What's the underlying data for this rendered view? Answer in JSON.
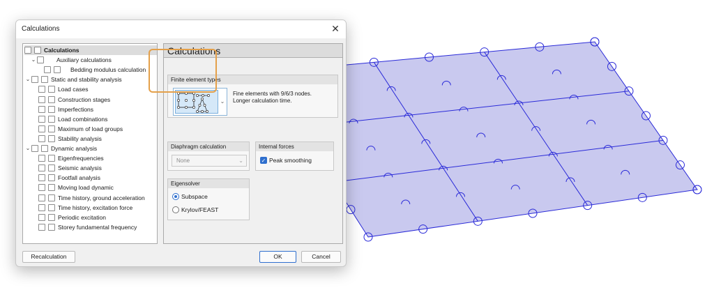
{
  "dialog": {
    "title": "Calculations",
    "close_glyph": "✕"
  },
  "tree": {
    "items": [
      {
        "label": "Calculations",
        "bold": true,
        "twisty": ""
      },
      {
        "label": "Auxiliary calculations",
        "twisty": "⌄"
      },
      {
        "label": "Bedding modulus calculation",
        "twisty": ""
      },
      {
        "label": "Static and stability analysis",
        "twisty": "⌄"
      },
      {
        "label": "Load cases",
        "twisty": ""
      },
      {
        "label": "Construction stages",
        "twisty": ""
      },
      {
        "label": "Imperfections",
        "twisty": ""
      },
      {
        "label": "Load combinations",
        "twisty": ""
      },
      {
        "label": "Maximum of load groups",
        "twisty": ""
      },
      {
        "label": "Stability analysis",
        "twisty": ""
      },
      {
        "label": "Dynamic analysis",
        "twisty": "⌄"
      },
      {
        "label": "Eigenfrequencies",
        "twisty": ""
      },
      {
        "label": "Seismic analysis",
        "twisty": ""
      },
      {
        "label": "Footfall analysis",
        "twisty": ""
      },
      {
        "label": "Moving load dynamic",
        "twisty": ""
      },
      {
        "label": "Time history, ground acceleration",
        "twisty": ""
      },
      {
        "label": "Time history, excitation force",
        "twisty": ""
      },
      {
        "label": "Periodic excitation",
        "twisty": ""
      },
      {
        "label": "Storey fundamental frequency",
        "twisty": ""
      }
    ]
  },
  "panel": {
    "title": "Calculations",
    "finite_element": {
      "header": "Finite element types",
      "description": "Fine elements with 9/6/3 nodes. Longer calculation time.",
      "dropdown_icon": "chevron-down-icon",
      "highlight_color": "#e4a04a"
    },
    "diaphragm": {
      "header": "Diaphragm calculation",
      "value": "None"
    },
    "internal_forces": {
      "header": "Internal forces",
      "peak_smoothing_label": "Peak smoothing",
      "peak_smoothing_checked": true
    },
    "eigensolver": {
      "header": "Eigensolver",
      "options": [
        "Subspace",
        "Krylov/FEAST"
      ],
      "selected": "Subspace"
    }
  },
  "buttons": {
    "recalculation": "Recalculation",
    "ok": "OK",
    "cancel": "Cancel"
  },
  "colors": {
    "accent": "#2f6fce",
    "mesh_fill": "#c9c9ef",
    "mesh_line": "#2a2ad8"
  }
}
